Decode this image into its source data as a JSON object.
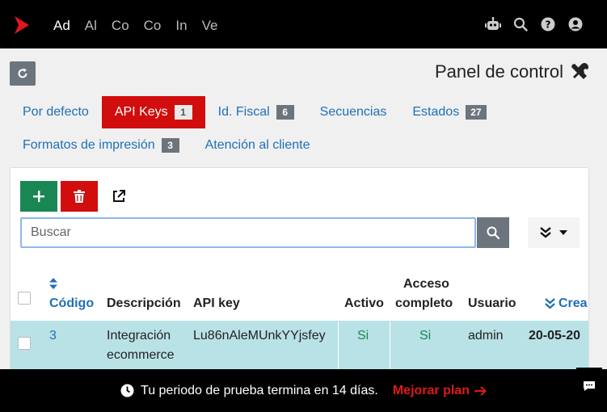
{
  "nav": {
    "items": [
      "Ad",
      "Al",
      "Co",
      "Co",
      "In",
      "Ve"
    ],
    "active_index": 0
  },
  "header": {
    "title": "Panel de control",
    "icons": [
      "robot-icon",
      "search-icon",
      "help-icon",
      "user-icon"
    ]
  },
  "tabs_row1": [
    {
      "label": "Por defecto",
      "badge": ""
    },
    {
      "label": "API Keys",
      "badge": "1"
    },
    {
      "label": "Id. Fiscal",
      "badge": "6"
    },
    {
      "label": "Secuencias",
      "badge": ""
    },
    {
      "label": "Estados",
      "badge": "27"
    }
  ],
  "tabs_row2": [
    {
      "label": "Formatos de impresión",
      "badge": "3"
    },
    {
      "label": "Atención al cliente",
      "badge": ""
    }
  ],
  "active_tab": "API Keys",
  "search": {
    "placeholder": "Buscar"
  },
  "table": {
    "headers": {
      "codigo": "Código",
      "descripcion": "Descripción",
      "apikey": "API key",
      "activo": "Activo",
      "acceso_line1": "Acceso",
      "acceso_line2": "completo",
      "usuario": "Usuario",
      "creacion": "Crea"
    },
    "rows": [
      {
        "codigo": "3",
        "descripcion_line1": "Integración",
        "descripcion_line2": "ecommerce",
        "apikey": "Lu86nAleMUnkYYjsfey",
        "activo": "Si",
        "acceso": "Si",
        "usuario": "admin",
        "creacion": "20-05-20"
      }
    ]
  },
  "footer": {
    "message": "Tu periodo de prueba termina en 14 días.",
    "upgrade": "Mejorar plan"
  },
  "colors": {
    "brand_red": "#d10d0d",
    "link_blue": "#1f6fb8",
    "add_green": "#198754",
    "row_highlight": "#b9e2e6"
  }
}
